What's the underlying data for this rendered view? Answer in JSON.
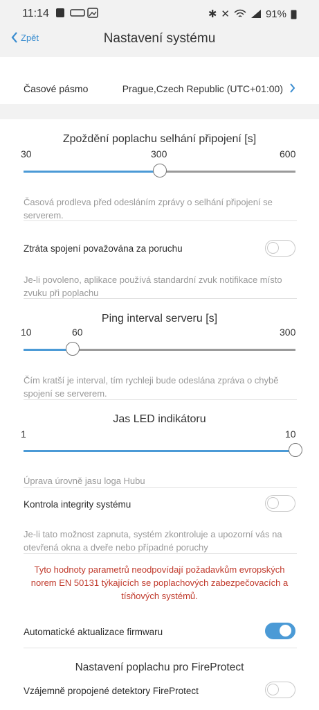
{
  "status_bar": {
    "time": "11:14",
    "battery": "91%"
  },
  "nav": {
    "back_label": "Zpět",
    "title": "Nastavení systému"
  },
  "timezone": {
    "label": "Časové pásmo",
    "value": "Prague,Czech Republic (UTC+01:00)"
  },
  "delay": {
    "title": "Zpoždění poplachu selhání připojení [s]",
    "min": "30",
    "current": "300",
    "max": "600",
    "level": 0.5,
    "note": "Časová prodleva před odesláním zprávy o selhání připojení se serverem."
  },
  "loss_fault": {
    "label": "Ztráta spojení považována za poruchu",
    "enabled": false,
    "note": "Je-li povoleno, aplikace používá standardní zvuk notifikace místo zvuku při poplachu"
  },
  "ping": {
    "title": "Ping interval serveru [s]",
    "min": "10",
    "current": "60",
    "max": "300",
    "level": 0.18,
    "note": "Čím kratší je interval, tím rychleji bude odeslána zpráva o chybě spojení se serverem."
  },
  "led": {
    "title": "Jas LED indikátoru",
    "min": "1",
    "max": "10",
    "level": 1.0,
    "note": "Úprava úrovně jasu loga Hubu"
  },
  "integrity": {
    "label": "Kontrola integrity systému",
    "enabled": false,
    "note": "Je-li tato možnost zapnuta, systém zkontroluje a upozorní vás na otevřená okna a dveře nebo případné poruchy"
  },
  "warning": "Tyto hodnoty parametrů neodpovídají požadavkům evropských norem EN 50131 týkajících se poplachových zabezpečovacích a tísňových systémů.",
  "firmware": {
    "label": "Automatické aktualizace firmwaru",
    "enabled": true
  },
  "fireprotect": {
    "title": "Nastavení poplachu pro FireProtect",
    "label": "Vzájemně propojené detektory FireProtect",
    "enabled": false
  },
  "colors": {
    "accent": "#4b9ad6",
    "warning": "#c0392b"
  }
}
